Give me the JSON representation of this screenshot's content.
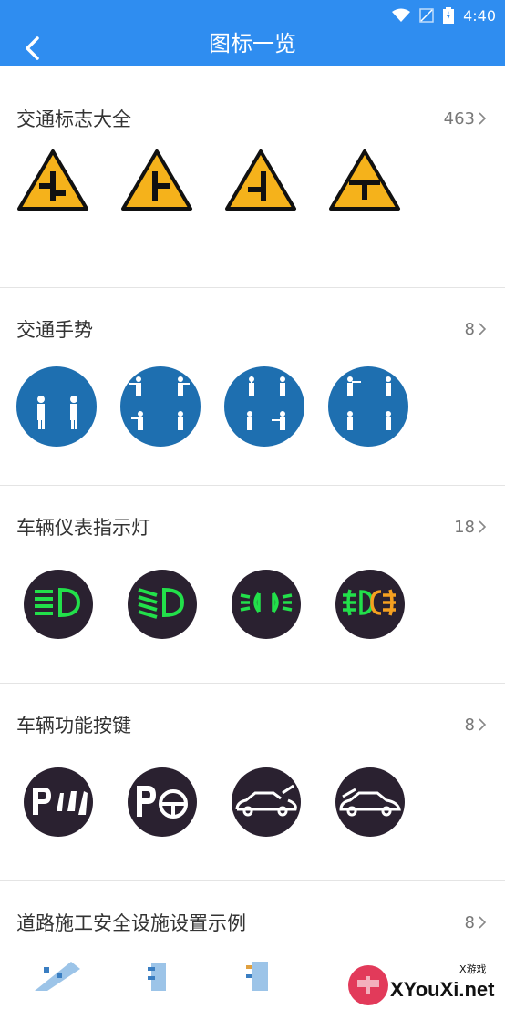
{
  "status": {
    "time": "4:40"
  },
  "appbar": {
    "title": "图标一览"
  },
  "sections": [
    {
      "title": "交通标志大全",
      "count": "463"
    },
    {
      "title": "交通手势",
      "count": "8"
    },
    {
      "title": "车辆仪表指示灯",
      "count": "18"
    },
    {
      "title": "车辆功能按键",
      "count": "8"
    },
    {
      "title": "道路施工安全设施设置示例",
      "count": "8"
    }
  ],
  "watermark": {
    "brand": "XYouXi.net",
    "tag": "X游戏"
  },
  "colors": {
    "primary": "#2f8df0",
    "sign_yellow": "#f5b21b",
    "gesture_blue": "#1e6fb0",
    "lamp_green": "#22e04a",
    "key_dark": "#2a2130"
  }
}
